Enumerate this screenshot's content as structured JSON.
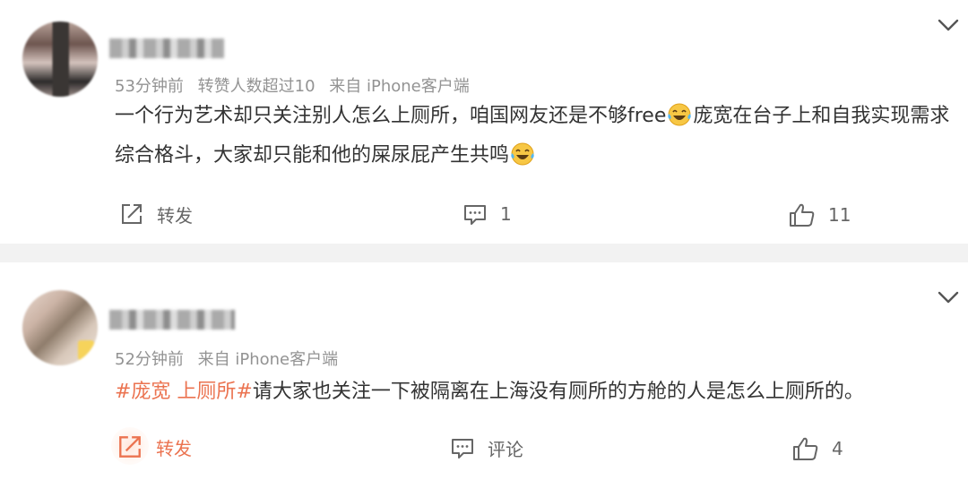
{
  "comments": [
    {
      "time": "53分钟前",
      "reposted": "转赞人数超过10",
      "source": "来自 iPhone客户端",
      "text_parts": [
        "一个行为艺术却只关注别人怎么上厕所，咱国网友还是不够free",
        "庞宽在台子上和自我实现需求综合格斗，大家却只能和他的屎尿屁产生共鸣"
      ],
      "emoji": "laughing-tears-emoji",
      "actions": {
        "repost": "转发",
        "comment": "1",
        "like": "11"
      }
    },
    {
      "time": "52分钟前",
      "source": "来自 iPhone客户端",
      "topic": "#庞宽 上厕所#",
      "text": "请大家也关注一下被隔离在上海没有厕所的方舱的人是怎么上厕所的。",
      "actions": {
        "repost": "转发",
        "comment": "评论",
        "like": "4"
      }
    }
  ],
  "colors": {
    "accent": "#eb7350",
    "meta": "#939393",
    "text": "#333333",
    "divider": "#f2f2f2"
  }
}
